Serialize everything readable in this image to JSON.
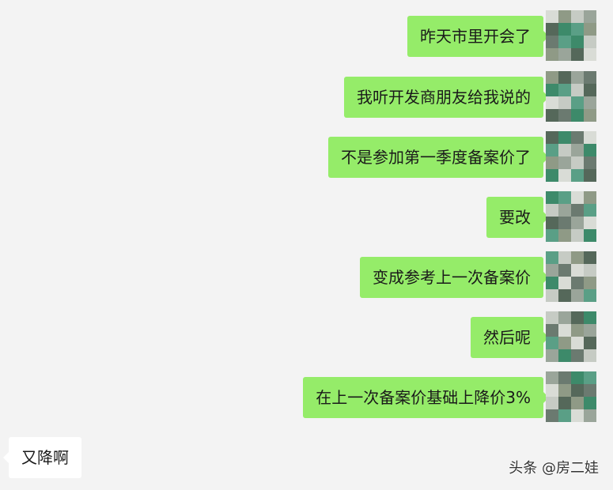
{
  "chat": {
    "messages": [
      {
        "side": "right",
        "text": "昨天市里开会了"
      },
      {
        "side": "right",
        "text": "我听开发商朋友给我说的"
      },
      {
        "side": "right",
        "text": "不是参加第一季度备案价了"
      },
      {
        "side": "right",
        "text": "要改"
      },
      {
        "side": "right",
        "text": "变成参考上一次备案价"
      },
      {
        "side": "right",
        "text": "然后呢"
      },
      {
        "side": "right",
        "text": "在上一次备案价基础上降价3%"
      },
      {
        "side": "left",
        "text": "又降啊"
      }
    ]
  },
  "watermark": {
    "text": "头条 @房二娃"
  },
  "colors": {
    "background": "#f3f3f3",
    "sent_bubble": "#95ec69",
    "received_bubble": "#ffffff",
    "text": "#1a1a1a"
  },
  "avatar": {
    "icon": "pixelated-avatar-icon",
    "palette": [
      "#d9dcd6",
      "#8f9a86",
      "#55685a",
      "#3d8a6a",
      "#5a9f86",
      "#c6cbc4",
      "#9aa59a",
      "#6b7a70"
    ]
  }
}
